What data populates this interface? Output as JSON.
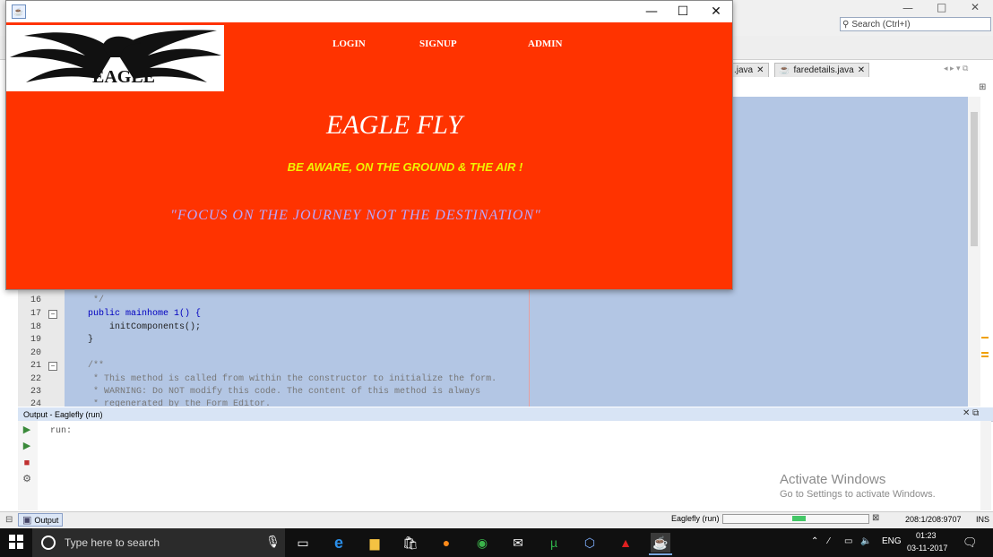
{
  "ide": {
    "search_placeholder": "Search (Ctrl+I)",
    "tabs": [
      ".java",
      "faredetails.java"
    ],
    "code_lines": [
      {
        "num": "16",
        "text": " */",
        "kind": "cm"
      },
      {
        "num": "17",
        "text": "public mainhome 1() {",
        "kind": "kw"
      },
      {
        "num": "18",
        "text": "    initComponents();",
        "kind": "code"
      },
      {
        "num": "19",
        "text": "}",
        "kind": "code"
      },
      {
        "num": "20",
        "text": "",
        "kind": "code"
      },
      {
        "num": "21",
        "text": "/**",
        "kind": "cm"
      },
      {
        "num": "22",
        "text": " * This method is called from within the constructor to initialize the form.",
        "kind": "cm"
      },
      {
        "num": "23",
        "text": " * WARNING: Do NOT modify this code. The content of this method is always",
        "kind": "cm"
      },
      {
        "num": "24",
        "text": " * regenerated by the Form Editor.",
        "kind": "cm"
      }
    ],
    "output_title": "Output - Eaglefly (run)",
    "output_text": "run:",
    "activate_title": "Activate Windows",
    "activate_sub": "Go to Settings to activate Windows.",
    "status_output_tab": "Output",
    "status_run": "Eaglefly (run)",
    "status_pos": "208:1/208:9707",
    "status_ins": "INS",
    "progress_fraction": 0.09
  },
  "taskbar": {
    "search_text": "Type here to search",
    "lang": "ENG",
    "time": "01:23",
    "date": "03-11-2017"
  },
  "app": {
    "logo_text": "EAGLE",
    "nav": {
      "login": "LOGIN",
      "signup": "SIGNUP",
      "admin": "ADMIN"
    },
    "title": "EAGLE FLY",
    "subtitle": "BE AWARE, ON THE GROUND & THE AIR !",
    "quote": "\"FOCUS ON THE JOURNEY NOT THE DESTINATION\"",
    "colors": {
      "background": "#ff3300",
      "title": "#ffffff",
      "subtitle": "#f2f200",
      "quote": "#b9a8ff"
    }
  }
}
